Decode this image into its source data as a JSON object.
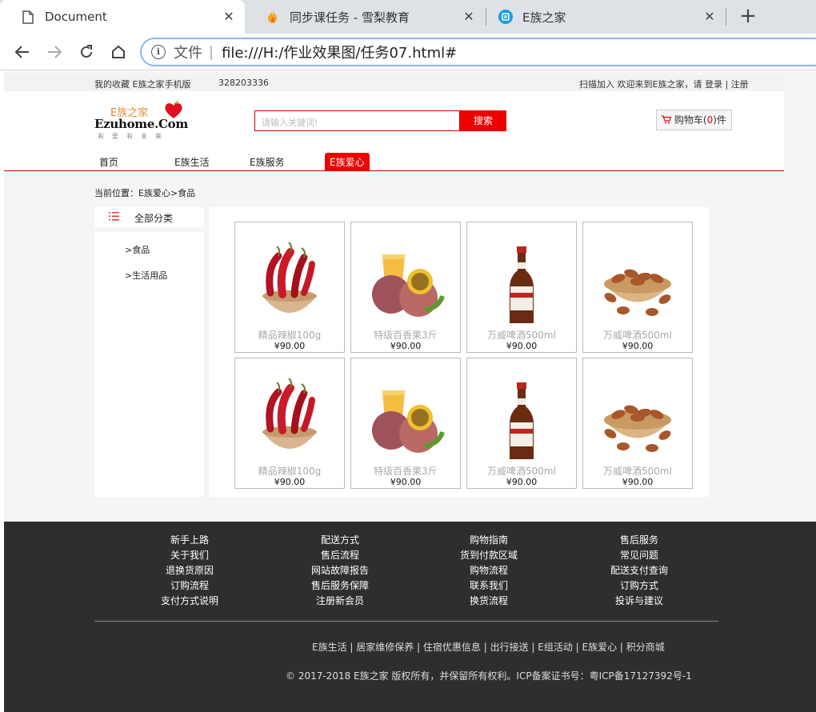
{
  "browser": {
    "tabs": [
      {
        "title": "Document",
        "icon": "document-icon"
      },
      {
        "title": "同步课任务 - 雪梨教育",
        "icon": "flame-icon"
      },
      {
        "title": "E族之家",
        "icon": "site-icon"
      }
    ],
    "address": {
      "scheme_label": "文件",
      "url": "file:///H:/作业效果图/任务07.html#"
    }
  },
  "topbar": {
    "left_links": "我的收藏 E族之家手机版",
    "qq": "328203336",
    "welcome": "扫描加入 欢迎来到E族之家，请",
    "login": "登录",
    "sep": "|",
    "register": "注册"
  },
  "header": {
    "logo": {
      "cn": "E族之家",
      "en": "Ezuhome.Com",
      "slogan": "有爱有未来"
    },
    "search": {
      "placeholder": "请输入关键词!",
      "button": "搜索"
    },
    "cart": {
      "label": "购物车(",
      "count": "0",
      "suffix": ")件"
    },
    "nav": [
      "首页",
      "E族生活",
      "E族服务",
      "E族爱心"
    ]
  },
  "breadcrumb": "当前位置：E族爱心>食品",
  "sidebar": {
    "title": "全部分类",
    "items": [
      ">食品",
      ">生活用品"
    ]
  },
  "products": [
    {
      "name": "精品辣椒100g",
      "price": "¥90.00",
      "image": "chili-bowl-image"
    },
    {
      "name": "特级百香果3斤",
      "price": "¥90.00",
      "image": "passion-fruit-image"
    },
    {
      "name": "万威啤酒500ml",
      "price": "¥90.00",
      "image": "beer-bottle-image"
    },
    {
      "name": "万威啤酒500ml",
      "price": "¥90.00",
      "image": "nuts-bowl-image"
    },
    {
      "name": "精品辣椒100g",
      "price": "¥90.00",
      "image": "chili-bowl-image"
    },
    {
      "name": "特级百香果3斤",
      "price": "¥90.00",
      "image": "passion-fruit-image"
    },
    {
      "name": "万威啤酒500ml",
      "price": "¥90.00",
      "image": "beer-bottle-image"
    },
    {
      "name": "万威啤酒500ml",
      "price": "¥90.00",
      "image": "nuts-bowl-image"
    }
  ],
  "footer": {
    "columns": [
      [
        "新手上路",
        "关于我们",
        "退换货原因",
        "订购流程",
        "支付方式说明"
      ],
      [
        "配送方式",
        "售后流程",
        "网站故障报告",
        "售后服务保障",
        "注册新会员"
      ],
      [
        "购物指南",
        "货到付款区域",
        "购物流程",
        "联系我们",
        "换货流程"
      ],
      [
        "售后服务",
        "常见问题",
        "配送支付查询",
        "订购方式",
        "投诉与建议"
      ]
    ],
    "links": "E族生活 | 居家维修保养 | 住宿优惠信息 | 出行接送 | E组活动 | E族爱心 | 积分商城",
    "copyright": "© 2017-2018 E族之家 版权所有，并保留所有权利。ICP备案证书号：粤ICP备17127392号-1"
  },
  "colors": {
    "accent": "#ee0000",
    "footer_bg": "#2e2e2e",
    "tab_bar": "#dee1e6"
  }
}
